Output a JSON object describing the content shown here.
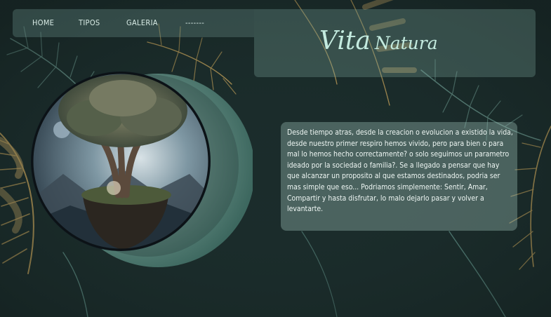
{
  "nav": {
    "items": [
      {
        "label": "HOME"
      },
      {
        "label": "TIPOS"
      },
      {
        "label": "GALERIA"
      },
      {
        "label": "-------"
      }
    ]
  },
  "brand": {
    "word1": "Vita",
    "word2": "Natura"
  },
  "main": {
    "paragraph": "Desde tiempo atras, desde la creacion o evolucion a existido la vida, desde nuestro primer respiro hemos vivido, pero para bien o para mal lo hemos hecho correctamente? o solo seguimos un parametro ideado por la sociedad o familia?. Se a llegado a pensar que hay que alcanzar un proposito al que estamos destinados, podria ser mas simple que eso... Podriamos simplemente: Sentir, Amar, Compartir y hasta disfrutar, lo malo dejarlo pasar y volver a levantarte."
  },
  "colors": {
    "background": "#1b2c2b",
    "accent_text": "#c4ebdf",
    "panel": "#7eaaa0",
    "leaf_gold": "#c9a45a",
    "leaf_green": "#5f8f86"
  },
  "images": {
    "hero": "tree-of-life-orb"
  }
}
